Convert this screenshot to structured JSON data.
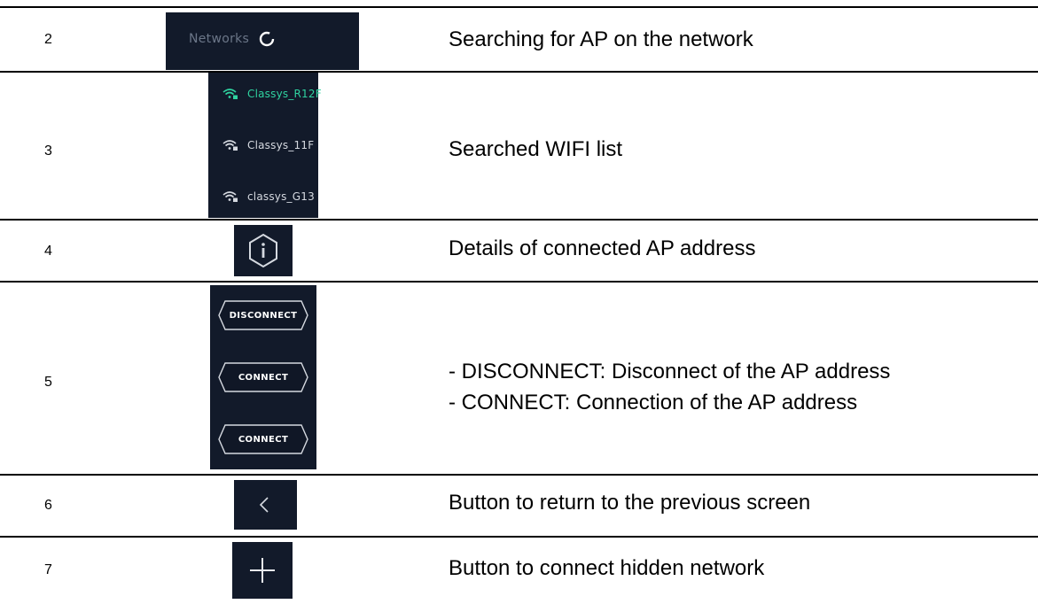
{
  "rows": [
    {
      "number": "2",
      "description": "Searching for AP on the network",
      "panel": {
        "label": "Networks",
        "icon": "spinner-icon"
      }
    },
    {
      "number": "3",
      "description": "Searched WIFI list",
      "panel": {
        "networks": [
          {
            "name": "Classys_R12F",
            "color": "#2fd3a0",
            "icon": "wifi-lock-icon"
          },
          {
            "name": "Classys_11F",
            "color": "#d5d9e0",
            "icon": "wifi-lock-icon"
          },
          {
            "name": "classys_G13",
            "color": "#d5d9e0",
            "icon": "wifi-lock-icon"
          }
        ]
      }
    },
    {
      "number": "4",
      "description": "Details of connected AP address",
      "panel": {
        "icon": "info-hexagon-icon"
      }
    },
    {
      "number": "5",
      "description_lines": [
        "- DISCONNECT: Disconnect of the AP address",
        "- CONNECT: Connection of the AP address"
      ],
      "panel": {
        "buttons": [
          "DISCONNECT",
          "CONNECT",
          "CONNECT"
        ]
      }
    },
    {
      "number": "6",
      "description": "Button to return to the previous screen",
      "panel": {
        "icon": "chevron-left-icon"
      }
    },
    {
      "number": "7",
      "description": "Button to connect hidden network",
      "panel": {
        "icon": "plus-icon"
      }
    }
  ],
  "colors": {
    "panel_bg": "#121a2a",
    "accent": "#2fd3a0",
    "rule": "#000000"
  }
}
